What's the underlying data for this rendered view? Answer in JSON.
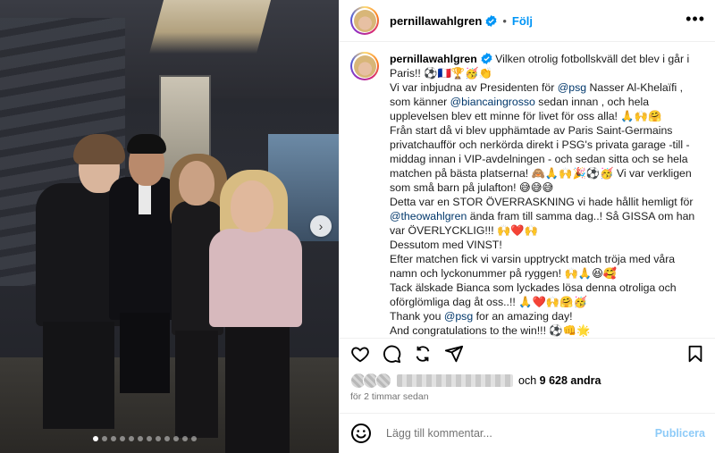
{
  "post": {
    "username": "pernillawahlgren",
    "follow_label": "Följ",
    "separator": "•",
    "more_label": "•••"
  },
  "photo": {
    "carousel_next": "›",
    "dot_count": 12,
    "active_dot": 0
  },
  "caption": {
    "username": "pernillawahlgren",
    "lines": [
      {
        "parts": [
          {
            "t": " Vilken otrolig fotbollskväll det blev i går i Paris!! ⚽🇫🇷🏆🥳👏"
          }
        ]
      },
      {
        "parts": [
          {
            "t": "Vi var inbjudna av Presidenten för "
          },
          {
            "t": "@psg",
            "m": true
          },
          {
            "t": " Nasser Al-Khelaïfi , som känner "
          },
          {
            "t": "@biancaingrosso",
            "m": true
          },
          {
            "t": " sedan innan , och hela upplevelsen blev ett minne för livet för oss alla! 🙏🙌🤗"
          }
        ]
      },
      {
        "parts": [
          {
            "t": "Från start då vi blev upphämtade av Paris Saint-Germains privatchaufför och nerkörda direkt i PSG's privata garage -till - middag innan i VIP-avdelningen - och sedan sitta och se hela matchen på bästa platserna! 🙈🙏🙌🎉⚽🥳 Vi var verkligen som små barn på julafton! 😅😅😅"
          }
        ]
      },
      {
        "parts": [
          {
            "t": "Detta var en STOR ÖVERRASKNING vi hade hållit hemligt för "
          },
          {
            "t": "@theowahlgren",
            "m": true
          },
          {
            "t": " ända fram till samma dag..! Så GISSA om han var ÖVERLYCKLIG!!! 🙌❤️🙌"
          }
        ]
      },
      {
        "parts": [
          {
            "t": "Dessutom med VINST!"
          }
        ]
      },
      {
        "parts": [
          {
            "t": "Efter matchen fick vi varsin upptryckt match tröja med våra namn och lyckonummer på ryggen! 🙌🙏😆🥰"
          }
        ]
      },
      {
        "parts": [
          {
            "t": "Tack älskade Bianca som lyckades lösa denna otroliga och oförglömliga dag åt oss..!! 🙏❤️🙌🤗🥳"
          }
        ]
      },
      {
        "parts": [
          {
            "t": "Thank you "
          },
          {
            "t": "@psg",
            "m": true
          },
          {
            "t": " for an amazing day!"
          }
        ]
      },
      {
        "parts": [
          {
            "t": "And congratulations to the win!!! ⚽👊🌟"
          }
        ]
      }
    ]
  },
  "actions": {
    "like_icon": "heart-icon",
    "comment_icon": "comment-icon",
    "share_icon": "share-icon",
    "send_icon": "send-icon",
    "save_icon": "bookmark-icon"
  },
  "likes": {
    "conjunction": "och",
    "count": "9 628",
    "suffix": "andra"
  },
  "time_ago": "för 2 timmar sedan",
  "comment": {
    "placeholder": "Lägg till kommentar...",
    "publish_label": "Publicera"
  },
  "colors": {
    "accent": "#0095f6",
    "mention": "#00376b",
    "publish_disabled": "#8ecbf8",
    "muted": "#737373"
  }
}
